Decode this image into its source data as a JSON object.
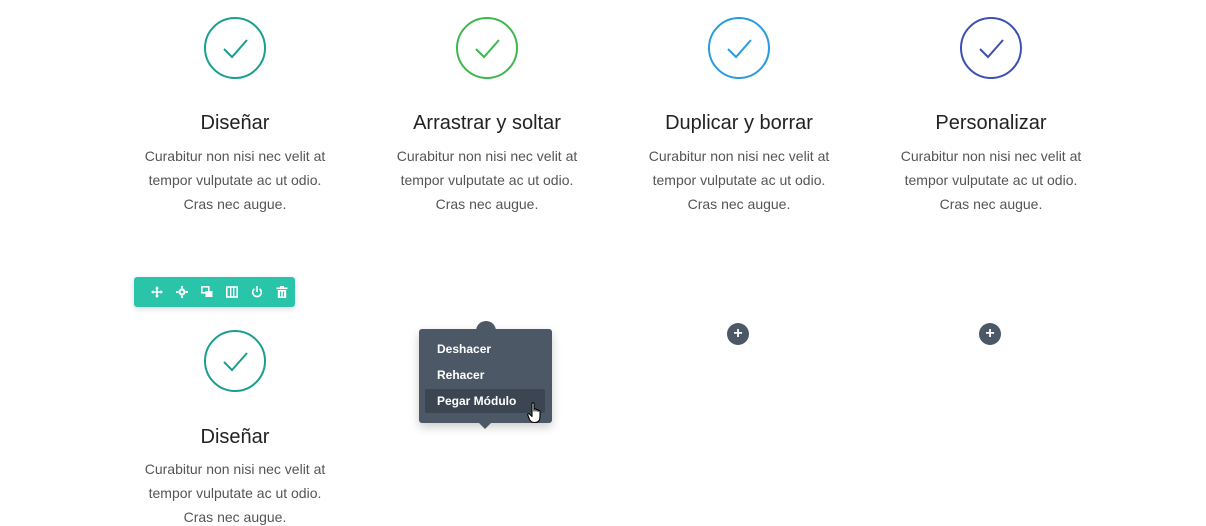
{
  "colors": {
    "teal": "#1a9f8e",
    "green": "#3db84f",
    "blue": "#2b9be0",
    "indigo": "#3d4fb0",
    "toolbar": "#29c4a9",
    "menu": "#4c5866"
  },
  "row1": [
    {
      "icon": "check-circle-icon",
      "title": "Diseñar",
      "body": "Curabitur non nisi nec velit at tempor vulputate ac ut odio. Cras nec augue."
    },
    {
      "icon": "check-circle-icon",
      "title": "Arrastrar y soltar",
      "body": "Curabitur non nisi nec velit at tempor vulputate ac ut odio. Cras nec augue."
    },
    {
      "icon": "check-circle-icon",
      "title": "Duplicar y borrar",
      "body": "Curabitur non nisi nec velit at tempor vulputate ac ut odio. Cras nec augue."
    },
    {
      "icon": "check-circle-icon",
      "title": "Personalizar",
      "body": "Curabitur non nisi nec velit at tempor vulputate ac ut odio. Cras nec augue."
    }
  ],
  "row2": {
    "blurb": {
      "icon": "check-circle-icon",
      "title": "Diseñar",
      "body": "Curabitur non nisi nec velit at tempor vulputate ac ut odio. Cras nec augue."
    },
    "add_label": "+"
  },
  "toolbar": {
    "buttons": [
      "move-icon",
      "settings-icon",
      "duplicate-icon",
      "columns-icon",
      "power-icon",
      "trash-icon"
    ]
  },
  "context_menu": {
    "items": [
      "Deshacer",
      "Rehacer",
      "Pegar Módulo"
    ],
    "hovered": "Pegar Módulo"
  }
}
